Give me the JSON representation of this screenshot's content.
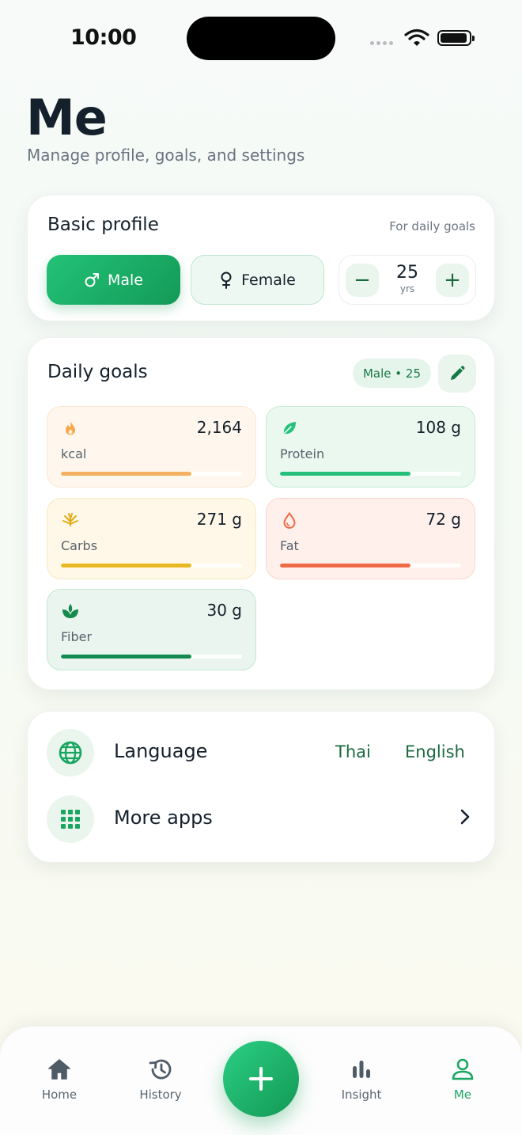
{
  "status_bar": {
    "time": "10:00"
  },
  "header": {
    "title": "Me",
    "subtitle": "Manage profile, goals, and settings"
  },
  "profile": {
    "title": "Basic profile",
    "note": "For daily goals",
    "male_label": "Male",
    "female_label": "Female",
    "selected_sex": "Male",
    "age": "25",
    "age_unit": "yrs",
    "minus": "−",
    "plus": "+"
  },
  "goals": {
    "title": "Daily goals",
    "badge": "Male • 25",
    "items": [
      {
        "value": "2,164",
        "label": "kcal",
        "fill_percent": 72,
        "color": "#f4b160",
        "icon": "flame-icon"
      },
      {
        "value": "108 g",
        "label": "Protein",
        "fill_percent": 72,
        "color": "#25c17a",
        "icon": "leaf-icon"
      },
      {
        "value": "271 g",
        "label": "Carbs",
        "fill_percent": 72,
        "color": "#e9b923",
        "icon": "wheat-icon"
      },
      {
        "value": "72 g",
        "label": "Fat",
        "fill_percent": 72,
        "color": "#ef6a47",
        "icon": "droplet-icon"
      },
      {
        "value": "30 g",
        "label": "Fiber",
        "fill_percent": 72,
        "color": "#158a4f",
        "icon": "sprout-icon"
      }
    ]
  },
  "settings": {
    "language_label": "Language",
    "language_options": [
      "Thai",
      "English"
    ],
    "more_apps_label": "More apps"
  },
  "nav": {
    "items": [
      "Home",
      "History",
      "Insight",
      "Me"
    ],
    "active": "Me"
  },
  "colors": {
    "accent": "#1aa661",
    "accent_dark": "#139a57"
  }
}
